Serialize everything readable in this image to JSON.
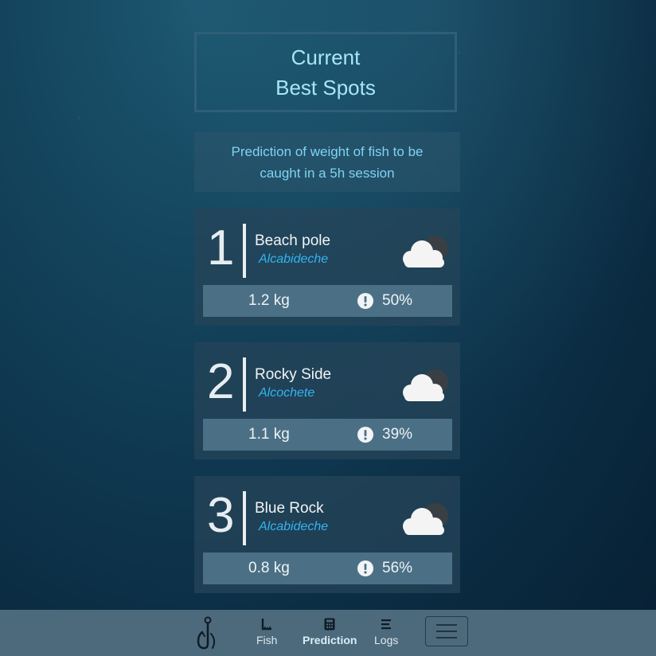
{
  "header": {
    "title_line1": "Current",
    "title_line2": "Best Spots"
  },
  "subtitle": "Prediction of weight of fish to be caught in a 5h session",
  "spots": [
    {
      "rank": "1",
      "name": "Beach pole",
      "city": "Alcabideche",
      "weight": "1.2 kg",
      "probability": "50%",
      "weather_icon": "cloud-night-icon"
    },
    {
      "rank": "2",
      "name": "Rocky Side",
      "city": "Alcochete",
      "weight": "1.1 kg",
      "probability": "39%",
      "weather_icon": "cloud-night-icon"
    },
    {
      "rank": "3",
      "name": "Blue Rock",
      "city": "Alcabideche",
      "weight": "0.8 kg",
      "probability": "56%",
      "weather_icon": "cloud-night-icon"
    }
  ],
  "nav": {
    "logo_icon": "fish-hook-icon",
    "items": [
      {
        "label": "Fish",
        "icon": "ruler-icon"
      },
      {
        "label": "Prediction",
        "icon": "calculator-icon",
        "active": true
      },
      {
        "label": "Logs",
        "icon": "list-icon"
      }
    ],
    "menu_icon": "hamburger-icon"
  },
  "colors": {
    "accent_text": "#7fd3f2",
    "city_text": "#34b4ef",
    "navbar_bg": "#4d6a7d",
    "stats_bg": "#4b7086"
  }
}
